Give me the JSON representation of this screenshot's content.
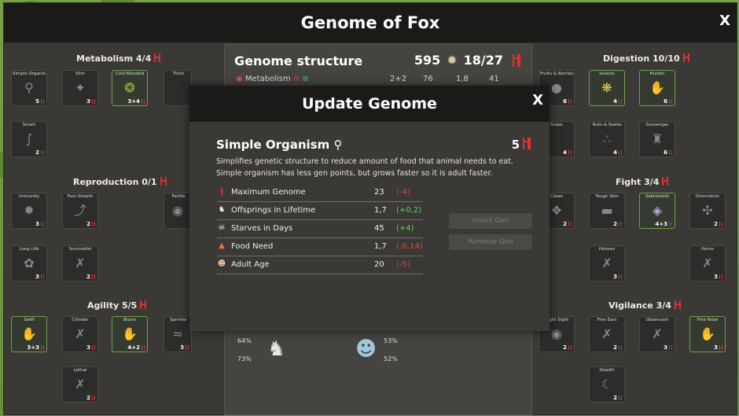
{
  "window": {
    "title": "Genome of Fox",
    "close_label": "X"
  },
  "sections": {
    "metabolism": "Metabolism 4/4",
    "reproduction": "Reproduction 0/1",
    "agility": "Agility 5/5",
    "digestion": "Digestion 10/10",
    "fight": "Fight 3/4",
    "vigilance": "Vigilance 3/4"
  },
  "tiles": {
    "simple_organism": {
      "name": "Simple Organism",
      "cost": "5"
    },
    "slim": {
      "name": "Slim",
      "cost": "3"
    },
    "cold_blooded": {
      "name": "Cold Blooded",
      "cost": "3+4"
    },
    "thick": {
      "name": "Thick",
      "cost": ""
    },
    "smart": {
      "name": "Smart",
      "cost": "2"
    },
    "immunity": {
      "name": "Immunity",
      "cost": "3"
    },
    "fast_growth": {
      "name": "Fast Growth",
      "cost": "2"
    },
    "fertile": {
      "name": "Fertile",
      "cost": ""
    },
    "long_life": {
      "name": "Long Life",
      "cost": "3"
    },
    "survivalist": {
      "name": "Survivalist",
      "cost": "2"
    },
    "swift": {
      "name": "Swift",
      "cost": "3+3"
    },
    "climber": {
      "name": "Climber",
      "cost": "3"
    },
    "brave": {
      "name": "Brave",
      "cost": "4+2"
    },
    "sprinter": {
      "name": "Sprinter",
      "cost": "3"
    },
    "lethal": {
      "name": "Lethal",
      "cost": "2"
    },
    "fruits_berries": {
      "name": "Fruits & Berries",
      "cost": "6"
    },
    "insects": {
      "name": "Insects",
      "cost": "4"
    },
    "hunter": {
      "name": "Hunter",
      "cost": "6"
    },
    "grass": {
      "name": "Grass",
      "cost": "4"
    },
    "nuts_seeds": {
      "name": "Nuts & Seeds",
      "cost": "4"
    },
    "scavenger": {
      "name": "Scavenger",
      "cost": "6"
    },
    "claws": {
      "name": "Claws",
      "cost": "2"
    },
    "tough_skin": {
      "name": "Tough Skin",
      "cost": "2"
    },
    "sabretooth": {
      "name": "Sabretooth",
      "cost": "4+3"
    },
    "orientation": {
      "name": "Orientation",
      "cost": "2"
    },
    "hooves": {
      "name": "Hooves",
      "cost": "3"
    },
    "horns": {
      "name": "Horns",
      "cost": "3"
    },
    "night_sight": {
      "name": "Night Sight",
      "cost": "2"
    },
    "fine_ears": {
      "name": "Fine Ears",
      "cost": "2"
    },
    "observant": {
      "name": "Observant",
      "cost": "3"
    },
    "fine_nose": {
      "name": "Fine Nose",
      "cost": "3"
    },
    "stealth": {
      "name": "Stealth",
      "cost": "2"
    }
  },
  "genome_structure": {
    "title": "Genome structure",
    "points": "595",
    "ratio": "18/27",
    "metabolism_label": "Metabolism",
    "metabolism_value": "2+2",
    "stat1": "76",
    "stat2": "1,8",
    "stat3": "41"
  },
  "bottom_stats": {
    "a": "64%",
    "b": "73%",
    "c": "53%",
    "d": "52%"
  },
  "dialog": {
    "title": "Update Genome",
    "close_label": "X",
    "item_name": "Simple Organism",
    "item_cost": "5",
    "description": "Simplifies genetic structure to reduce amount of food that animal needs to eat. Simple organism has less gen points, but grows faster so it is adult faster.",
    "stats": [
      {
        "label": "Maximum Genome",
        "value": "23",
        "delta": "(-4)",
        "sign": "neg",
        "icon": "dna-icon"
      },
      {
        "label": "Offsprings in Lifetime",
        "value": "1,7",
        "delta": "(+0,2)",
        "sign": "pos",
        "icon": "offspring-icon"
      },
      {
        "label": "Starves in Days",
        "value": "45",
        "delta": "(+4)",
        "sign": "pos",
        "icon": "skull-icon"
      },
      {
        "label": "Food Need",
        "value": "1,7",
        "delta": "(-0,14)",
        "sign": "neg",
        "icon": "flame-icon"
      },
      {
        "label": "Adult Age",
        "value": "20",
        "delta": "(-5)",
        "sign": "neg",
        "icon": "face-icon"
      }
    ],
    "insert_label": "Insert Gen",
    "remove_label": "Remove Gen"
  }
}
